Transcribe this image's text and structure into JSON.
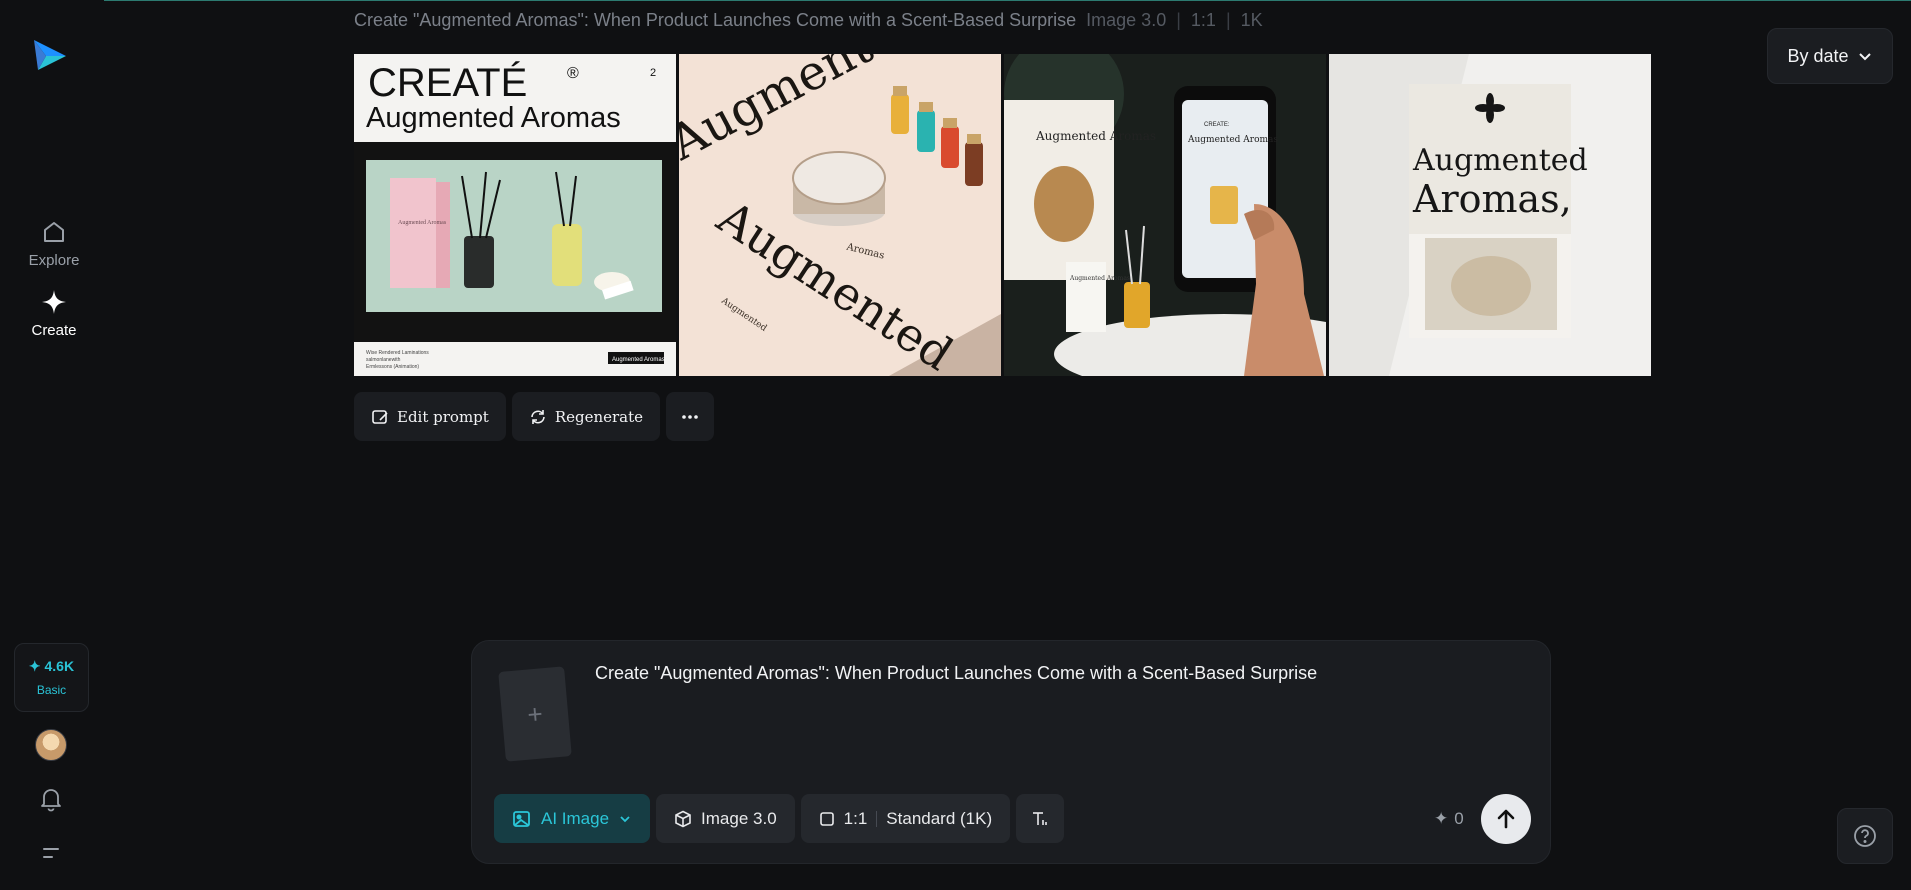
{
  "app": {
    "logo": "paper-plane-logo",
    "accent_color": "#2ac3d6"
  },
  "sidebar": {
    "items": [
      {
        "label": "Explore",
        "icon": "home-icon"
      },
      {
        "label": "Create",
        "icon": "sparkle-icon"
      }
    ],
    "credits": {
      "value": "✦ 4.6K",
      "plan": "Basic"
    },
    "icons": [
      "avatar",
      "bell-icon",
      "menu-icon"
    ]
  },
  "header": {
    "prompt_title": "Create \"Augmented Aromas\": When Product Launches Come with a Scent-Based Surprise",
    "model": "Image 3.0",
    "ratio": "1:1",
    "resolution": "1K",
    "sort_label": "By date"
  },
  "gallery": {
    "images": [
      {
        "brand_top": "CREATÉ",
        "reg_mark": "®",
        "brand_sub": "Augmented Aromas",
        "page_num": "2",
        "small_label": "Augmented Aromas",
        "box_label": "Augmented Aromas",
        "footer_lines": [
          "Wise Rendered Laminations",
          "salmonlanewith",
          "Ermlessons (Animation)"
        ]
      },
      {
        "word_top": "Augmented",
        "word_side": "Augmented",
        "jar_label": "Aromas",
        "small_label": "Augmented"
      },
      {
        "book_title": "Augmented Aromas",
        "phone_head": "CREATE:",
        "phone_title": "Augmented Aromas",
        "box_label": "Augmented Aromas"
      },
      {
        "line1": "Augmented",
        "line2": "Aromas,"
      }
    ]
  },
  "actions": {
    "edit_prompt": "Edit prompt",
    "regenerate": "Regenerate"
  },
  "composer": {
    "prompt": "Create \"Augmented Aromas\": When Product Launches Come with a Scent-Based Surprise",
    "mode": "AI Image",
    "model": "Image 3.0",
    "ratio": "1:1",
    "quality": "Standard (1K)",
    "cost": "0",
    "cost_icon": "✦"
  }
}
